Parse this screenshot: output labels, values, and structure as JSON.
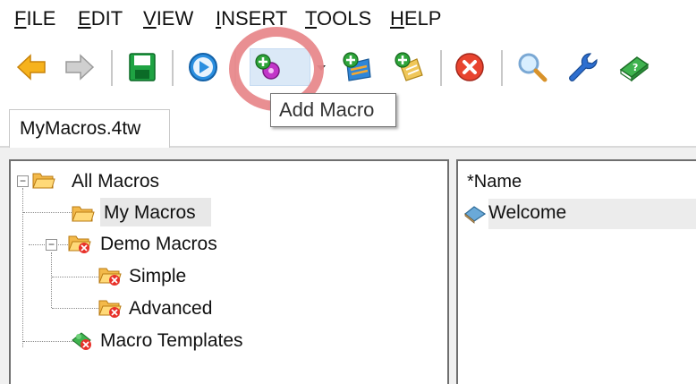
{
  "menu": {
    "file": {
      "accel": "F",
      "rest": "ILE"
    },
    "edit": {
      "accel": "E",
      "rest": "DIT"
    },
    "view": {
      "accel": "V",
      "rest": "IEW"
    },
    "insert": {
      "accel": "I",
      "rest": "NSERT"
    },
    "tools": {
      "accel": "T",
      "rest": "OOLS"
    },
    "help": {
      "accel": "H",
      "rest": "ELP"
    }
  },
  "toolbar": {
    "buttons": [
      {
        "icon": "back-arrow-icon"
      },
      {
        "icon": "forward-arrow-icon"
      },
      {
        "icon": "save-icon"
      },
      {
        "icon": "play-icon"
      },
      {
        "icon": "add-macro-icon"
      },
      {
        "icon": "dropdown-arrow-icon"
      },
      {
        "icon": "add-folder-icon"
      },
      {
        "icon": "add-template-icon"
      },
      {
        "icon": "delete-icon"
      },
      {
        "icon": "search-icon"
      },
      {
        "icon": "wrench-icon"
      },
      {
        "icon": "help-book-icon"
      }
    ],
    "tooltip": "Add Macro"
  },
  "tab": {
    "label": "MyMacros.4tw"
  },
  "tree": {
    "root": "All Macros",
    "items": [
      "My Macros",
      "Demo Macros",
      "Simple",
      "Advanced",
      "Macro Templates"
    ]
  },
  "list": {
    "header": "*Name",
    "rows": [
      "Welcome"
    ]
  },
  "colors": {
    "highlight_ring": "#e8898c",
    "selection": "#dbe9f7"
  }
}
